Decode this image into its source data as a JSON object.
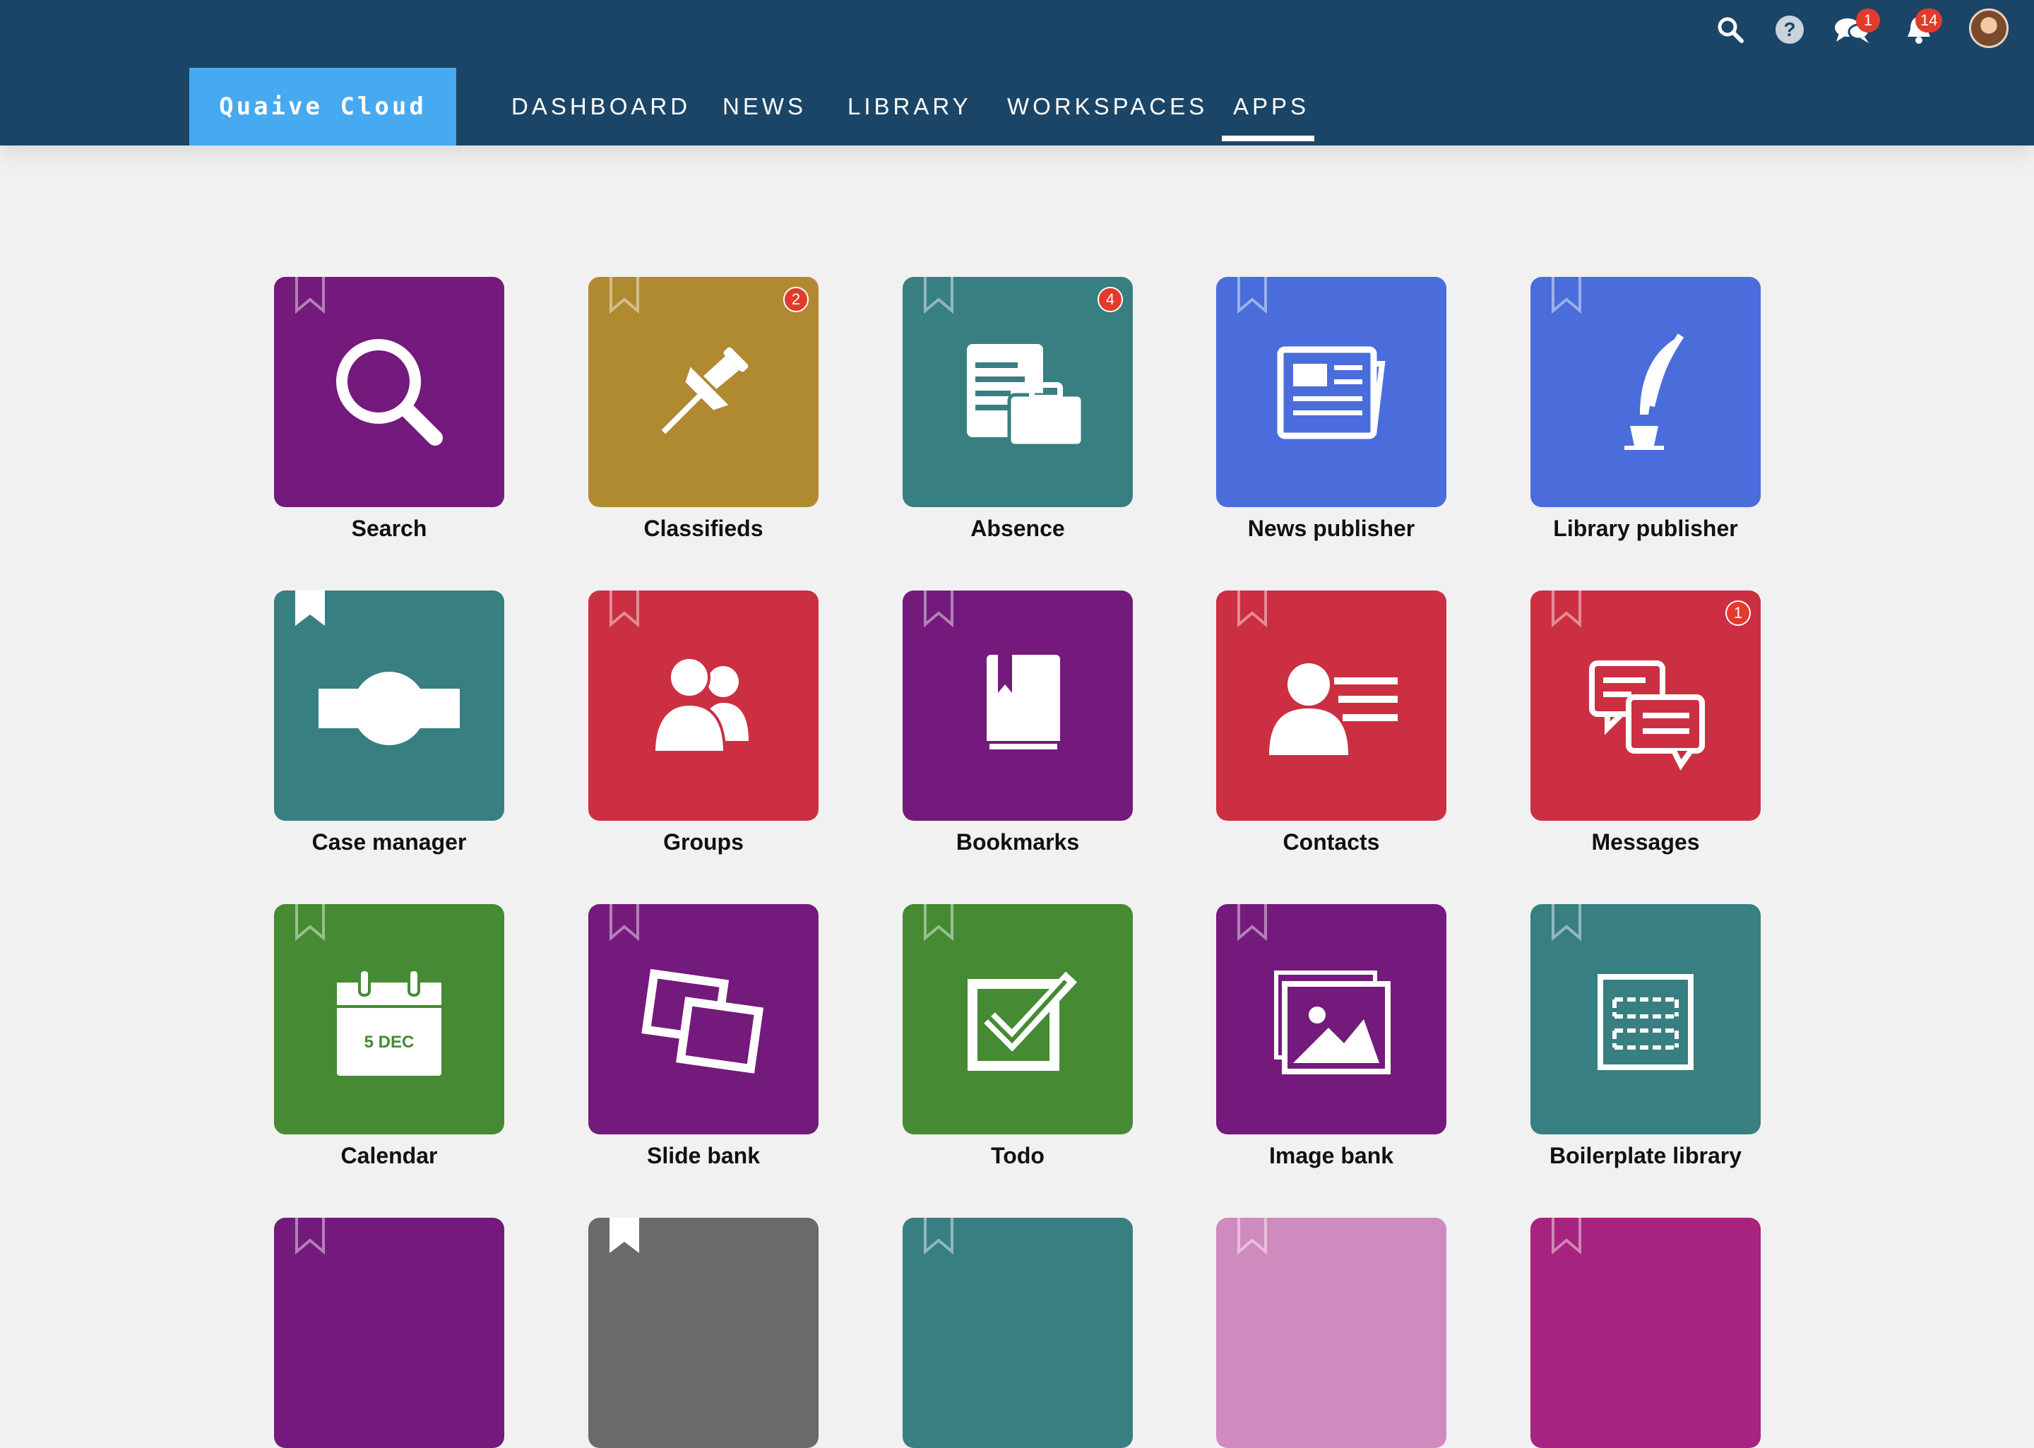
{
  "brand": "Quaive Cloud",
  "nav": [
    {
      "label": "DASHBOARD",
      "active": false
    },
    {
      "label": "NEWS",
      "active": false
    },
    {
      "label": "LIBRARY",
      "active": false
    },
    {
      "label": "WORKSPACES",
      "active": false
    },
    {
      "label": "APPS",
      "active": true
    }
  ],
  "header_icons": {
    "search": "search-icon",
    "help": "help-icon",
    "messages": {
      "icon": "chat-bubbles-icon",
      "badge": "1"
    },
    "notifications": {
      "icon": "bell-icon",
      "badge": "14"
    },
    "avatar": "user-avatar"
  },
  "colors": {
    "header": "#1b4566",
    "brand": "#47a9ef",
    "purple": "#741a7c",
    "gold": "#b08a30",
    "teal": "#387f81",
    "blue": "#4a6ddb",
    "red": "#cc2f42",
    "green": "#468a34",
    "gray": "#6a6a6a",
    "pink": "#d08bbe",
    "magenta": "#a6237f",
    "badge": "#e23b2b"
  },
  "apps": [
    {
      "label": "Search",
      "icon": "magnifier-icon",
      "color": "#741a7c",
      "badge": "",
      "bookmarked": false
    },
    {
      "label": "Classifieds",
      "icon": "pushpin-icon",
      "color": "#b08a30",
      "badge": "2",
      "bookmarked": false
    },
    {
      "label": "Absence",
      "icon": "document-briefcase-icon",
      "color": "#387f81",
      "badge": "4",
      "bookmarked": false
    },
    {
      "label": "News publisher",
      "icon": "newspaper-icon",
      "color": "#4a6ddb",
      "badge": "",
      "bookmarked": false
    },
    {
      "label": "Library publisher",
      "icon": "quill-icon",
      "color": "#4a6ddb",
      "badge": "",
      "bookmarked": false
    },
    {
      "label": "Case manager",
      "icon": "case-icon",
      "color": "#387f81",
      "badge": "",
      "bookmarked": true
    },
    {
      "label": "Groups",
      "icon": "group-icon",
      "color": "#cc2f42",
      "badge": "",
      "bookmarked": false
    },
    {
      "label": "Bookmarks",
      "icon": "book-icon",
      "color": "#741a7c",
      "badge": "",
      "bookmarked": false
    },
    {
      "label": "Contacts",
      "icon": "contact-card-icon",
      "color": "#cc2f42",
      "badge": "",
      "bookmarked": false
    },
    {
      "label": "Messages",
      "icon": "speech-bubbles-icon",
      "color": "#cc2f42",
      "badge": "1",
      "bookmarked": false
    },
    {
      "label": "Calendar",
      "icon": "calendar-icon",
      "color": "#468a34",
      "badge": "",
      "bookmarked": false,
      "icon_text": "5 DEC"
    },
    {
      "label": "Slide bank",
      "icon": "slides-icon",
      "color": "#741a7c",
      "badge": "",
      "bookmarked": false
    },
    {
      "label": "Todo",
      "icon": "checkbox-icon",
      "color": "#468a34",
      "badge": "",
      "bookmarked": false
    },
    {
      "label": "Image bank",
      "icon": "images-icon",
      "color": "#741a7c",
      "badge": "",
      "bookmarked": false
    },
    {
      "label": "Boilerplate library",
      "icon": "boilerplate-icon",
      "color": "#387f81",
      "badge": "",
      "bookmarked": false
    },
    {
      "label": "",
      "icon": "",
      "color": "#741a7c",
      "badge": "",
      "bookmarked": false
    },
    {
      "label": "",
      "icon": "",
      "color": "#6a6a6a",
      "badge": "",
      "bookmarked": true
    },
    {
      "label": "",
      "icon": "",
      "color": "#387f81",
      "badge": "",
      "bookmarked": false
    },
    {
      "label": "",
      "icon": "",
      "color": "#d08bbe",
      "badge": "",
      "bookmarked": false
    },
    {
      "label": "",
      "icon": "",
      "color": "#a6237f",
      "badge": "",
      "bookmarked": false
    }
  ]
}
